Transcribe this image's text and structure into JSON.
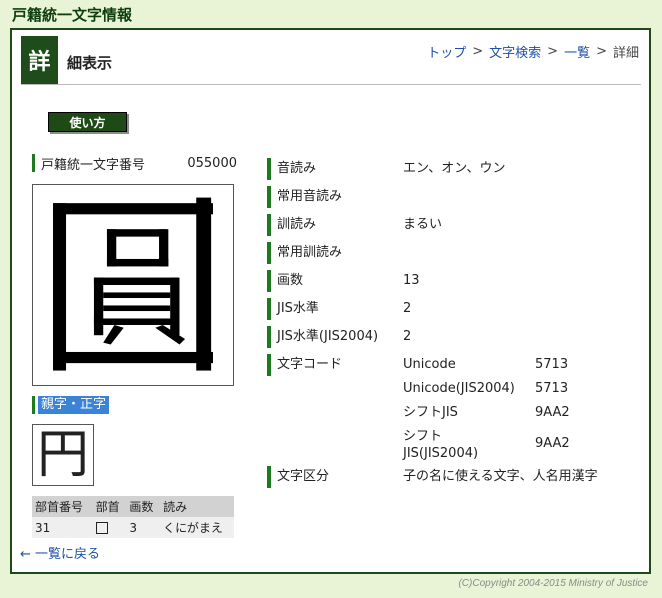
{
  "site_title": "戸籍統一文字情報",
  "header": {
    "badge": "詳",
    "title": "細表示",
    "breadcrumb": [
      {
        "label": "トップ",
        "link": true
      },
      {
        "label": "文字検索",
        "link": true
      },
      {
        "label": "一覧",
        "link": true
      },
      {
        "label": "詳細",
        "link": false
      }
    ],
    "separator": ">"
  },
  "usage_button": "使い方",
  "koseki": {
    "label": "戸籍統一文字番号",
    "number": "055000"
  },
  "glyph_char": "圓",
  "oyaji": {
    "label": "親字・正字",
    "char": "円"
  },
  "radical_table": {
    "headers": [
      "部首番号",
      "部首",
      "画数",
      "読み"
    ],
    "row": {
      "number": "31",
      "stroke": "3",
      "reading": "くにがまえ"
    }
  },
  "back_link": "← 一覧に戻る",
  "info": {
    "on_yomi": {
      "label": "音読み",
      "value": "エン、オン、ウン"
    },
    "joyo_on": {
      "label": "常用音読み",
      "value": ""
    },
    "kun_yomi": {
      "label": "訓読み",
      "value": "まるい"
    },
    "joyo_kun": {
      "label": "常用訓読み",
      "value": ""
    },
    "kakusu": {
      "label": "画数",
      "value": "13"
    },
    "jis_level": {
      "label": "JIS水準",
      "value": "2"
    },
    "jis_level_2004": {
      "label": "JIS水準(JIS2004)",
      "value": "2"
    },
    "char_code": {
      "label": "文字コード",
      "codes": [
        {
          "name": "Unicode",
          "value": "5713"
        },
        {
          "name": "Unicode(JIS2004)",
          "value": "5713"
        },
        {
          "name": "シフトJIS",
          "value": "9AA2"
        },
        {
          "name": "シフト\nJIS(JIS2004)",
          "value": "9AA2"
        }
      ]
    },
    "char_class": {
      "label": "文字区分",
      "value": "子の名に使える文字、人名用漢字"
    }
  },
  "copyright": "(C)Copyright 2004-2015 Ministry of Justice"
}
